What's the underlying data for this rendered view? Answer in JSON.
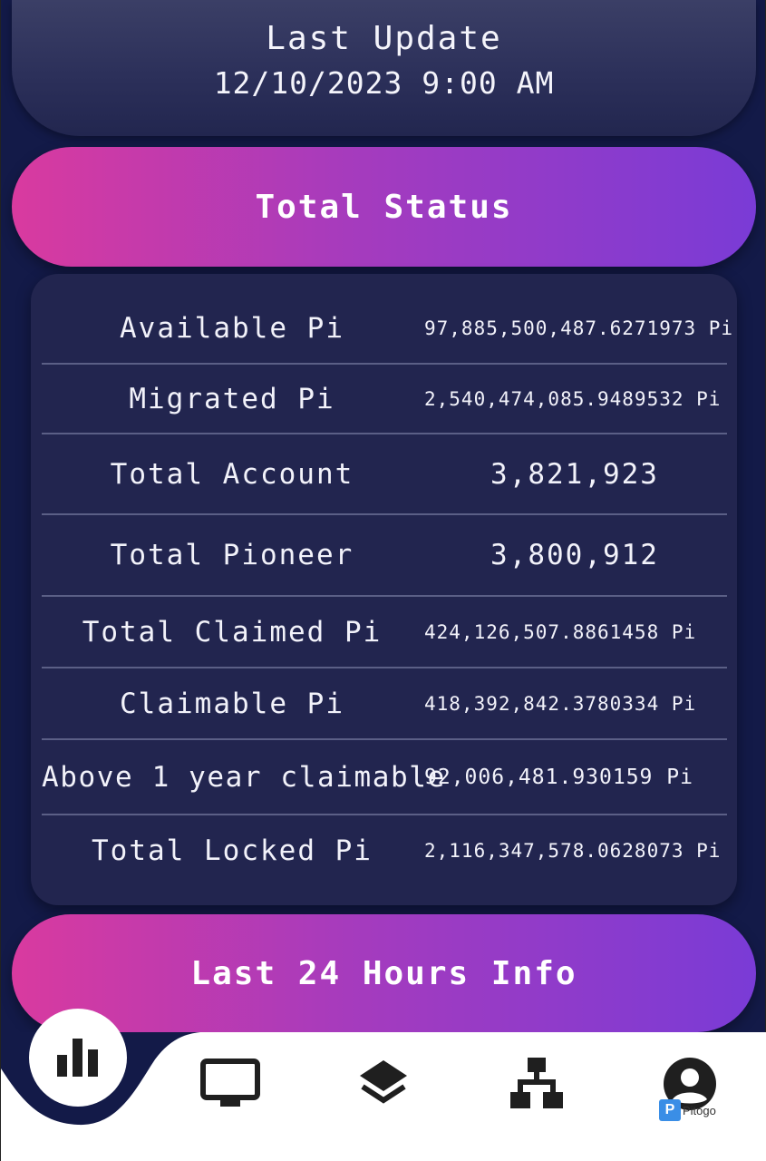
{
  "header": {
    "title": "Last Update",
    "timestamp": "12/10/2023 9:00 AM"
  },
  "total_status": {
    "title": "Total Status",
    "rows": [
      {
        "label": "Available Pi",
        "value": "97,885,500,487.6271973 Pi"
      },
      {
        "label": "Migrated Pi",
        "value": "2,540,474,085.9489532 Pi"
      },
      {
        "label": "Total Account",
        "value": "3,821,923"
      },
      {
        "label": "Total Pioneer",
        "value": "3,800,912"
      },
      {
        "label": "Total Claimed Pi",
        "value": "424,126,507.8861458 Pi"
      },
      {
        "label": "Claimable Pi",
        "value": "418,392,842.3780334 Pi"
      },
      {
        "label": "Above 1 year claimable",
        "value": "92,006,481.930159 Pi"
      },
      {
        "label": "Total Locked Pi",
        "value": "2,116,347,578.0628073 Pi"
      }
    ]
  },
  "last_24h": {
    "title": "Last 24 Hours Info"
  },
  "nav": {
    "items": [
      {
        "icon": "bar-chart-icon",
        "active": true
      },
      {
        "icon": "monitor-icon",
        "active": false
      },
      {
        "icon": "layers-icon",
        "active": false
      },
      {
        "icon": "sitemap-icon",
        "active": false
      },
      {
        "icon": "account-icon",
        "active": false
      }
    ]
  },
  "watermark": {
    "badge": "P",
    "text": "Pitogo"
  },
  "colors": {
    "background": "#131a48",
    "card": "#22254f",
    "gradient_start": "#d93a9f",
    "gradient_end": "#7a3bd6",
    "divider": "#5b5f86",
    "nav_bg": "#ffffff",
    "nav_icon": "#1f1f1f"
  }
}
